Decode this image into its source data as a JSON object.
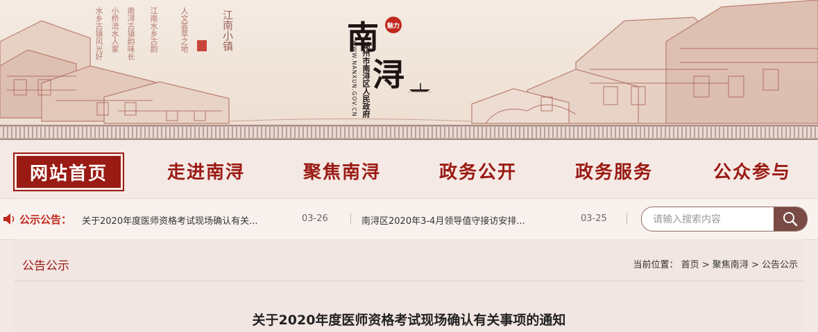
{
  "banner": {
    "logo_char_1": "南",
    "logo_char_2": "浔",
    "seal_text": "魅力",
    "gov_name": "湖州市南浔区人民政府",
    "gov_url": "WWW.NANXUN.GOV.CN",
    "poem_lines": [
      "水乡古镇风光好",
      "小桥流水人家",
      "南浔古镇韵味长",
      "江南水乡古韵",
      "人文荟萃之地"
    ],
    "poem_title": "江南小镇"
  },
  "nav": {
    "items": [
      {
        "label": "网站首页",
        "active": true
      },
      {
        "label": "走进南浔"
      },
      {
        "label": "聚焦南浔"
      },
      {
        "label": "政务公开"
      },
      {
        "label": "政务服务"
      },
      {
        "label": "公众参与"
      }
    ]
  },
  "notice": {
    "label": "公示公告：",
    "items": [
      {
        "title": "关于2020年度医师资格考试现场确认有关...",
        "date": "03-26"
      },
      {
        "title": "南浔区2020年3-4月领导值守接访安排...",
        "date": "03-25"
      }
    ]
  },
  "search": {
    "placeholder": "请输入搜索内容"
  },
  "content": {
    "section_title": "公告公示",
    "breadcrumb_prefix": "当前位置：",
    "breadcrumb": [
      "首页",
      "聚焦南浔",
      "公告公示"
    ],
    "breadcrumb_sep": " > ",
    "article_title": "关于2020年度医师资格考试现场确认有关事项的通知"
  },
  "colors": {
    "accent": "#9a1a14",
    "seal": "#c0281e",
    "search_button": "#7a4a44"
  }
}
